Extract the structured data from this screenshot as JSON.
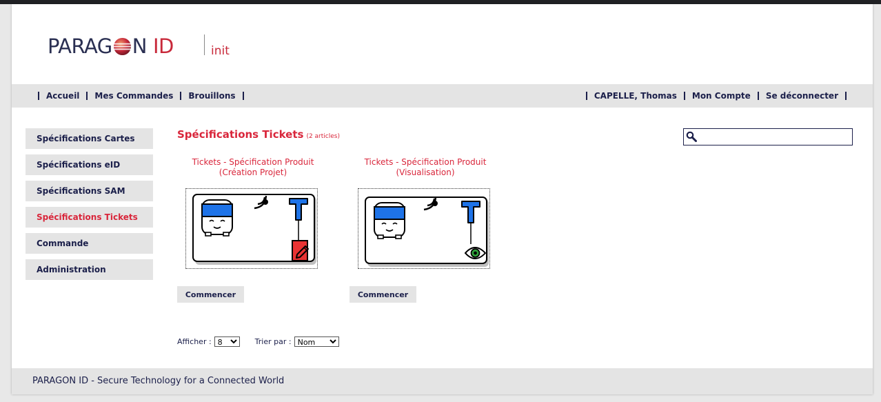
{
  "header": {
    "logo_main": "PARAG",
    "logo_after_globe": "N",
    "logo_id": "ID",
    "logo_sub": "init"
  },
  "nav": {
    "left": [
      "Accueil",
      "Mes Commandes",
      "Brouillons"
    ],
    "right": [
      "CAPELLE, Thomas",
      "Mon Compte",
      "Se déconnecter"
    ]
  },
  "sidebar": {
    "items": [
      {
        "label": "Spécifications Cartes",
        "active": false
      },
      {
        "label": "Spécifications eID",
        "active": false
      },
      {
        "label": "Spécifications SAM",
        "active": false
      },
      {
        "label": "Spécifications Tickets",
        "active": true
      },
      {
        "label": "Commande",
        "active": false
      },
      {
        "label": "Administration",
        "active": false
      }
    ]
  },
  "main": {
    "title": "Spécifications Tickets",
    "count": "(2 articles)",
    "search": {
      "value": "",
      "placeholder": ""
    },
    "products": [
      {
        "title": "Tickets - Spécification Produit (Création Projet)",
        "badge": "edit-icon",
        "button": "Commencer"
      },
      {
        "title": "Tickets - Spécification Produit (Visualisation)",
        "badge": "eye-icon",
        "button": "Commencer"
      }
    ],
    "afficher_label": "Afficher :",
    "afficher_value": "8",
    "trier_label": "Trier par :",
    "trier_value": "Nom"
  },
  "footer": {
    "text": "PARAGON ID - Secure Technology for a Connected World"
  },
  "colors": {
    "accent_red": "#d9263b",
    "navy": "#1b1f4a",
    "gray_bar": "#e4e4e4",
    "ticket_blue": "#1e73e8"
  }
}
